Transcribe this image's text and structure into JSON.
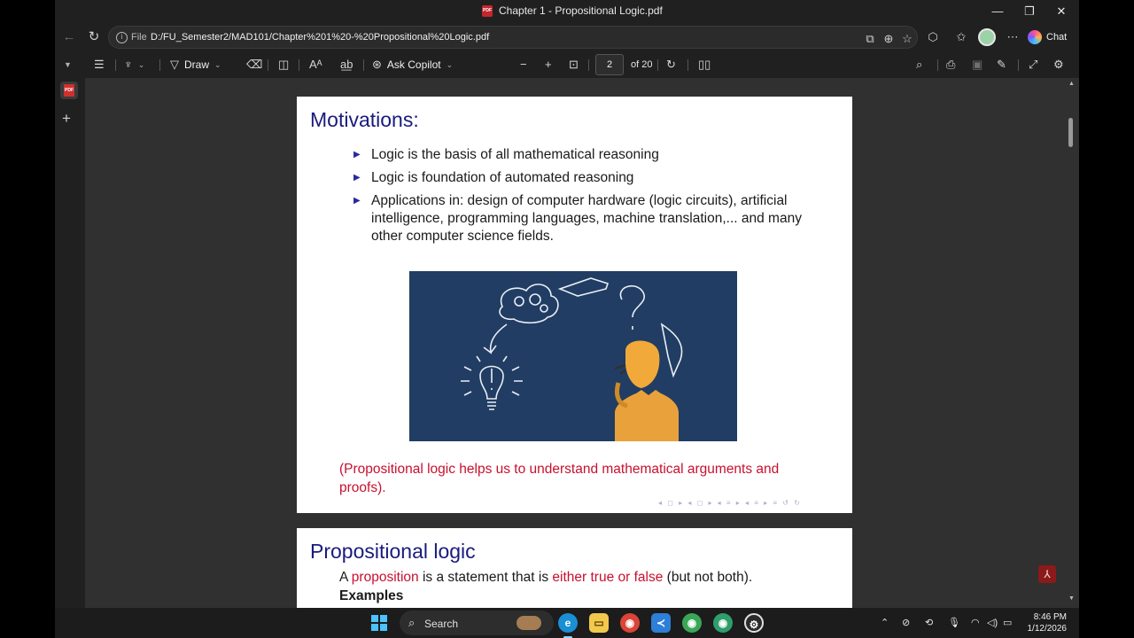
{
  "window": {
    "title": "Chapter 1 - Propositional Logic.pdf",
    "controls": [
      "—",
      "❐",
      "✕"
    ]
  },
  "address_bar": {
    "scheme_label": "File",
    "url": "D:/FU_Semester2/MAD101/Chapter%201%20-%20Propositional%20Logic.pdf",
    "chat_label": "Chat"
  },
  "pdf_toolbar": {
    "draw_label": "Draw",
    "copilot_label": "Ask Copilot",
    "current_page": "2",
    "page_count": "of 20"
  },
  "slide1": {
    "title": "Motivations:",
    "bullets": [
      "Logic is the basis of all mathematical reasoning",
      "Logic is foundation of automated reasoning",
      "Applications in: design of computer hardware (logic circuits), artificial intelligence, programming languages, machine translation,... and many other computer science fields."
    ],
    "note": "(Propositional logic helps us to understand mathematical arguments and proofs).",
    "accent_color": "#1a1a7e",
    "note_color": "#c8102e"
  },
  "slide2": {
    "title": "Propositional logic",
    "line_a": "A",
    "line_term": "proposition",
    "line_b": "is a statement that is",
    "line_em": "either true or false",
    "line_c": "(but not both).",
    "examples_label": "Examples"
  },
  "taskbar": {
    "search_label": "Search",
    "time": "8:46 PM",
    "date": "1/12/2026"
  }
}
